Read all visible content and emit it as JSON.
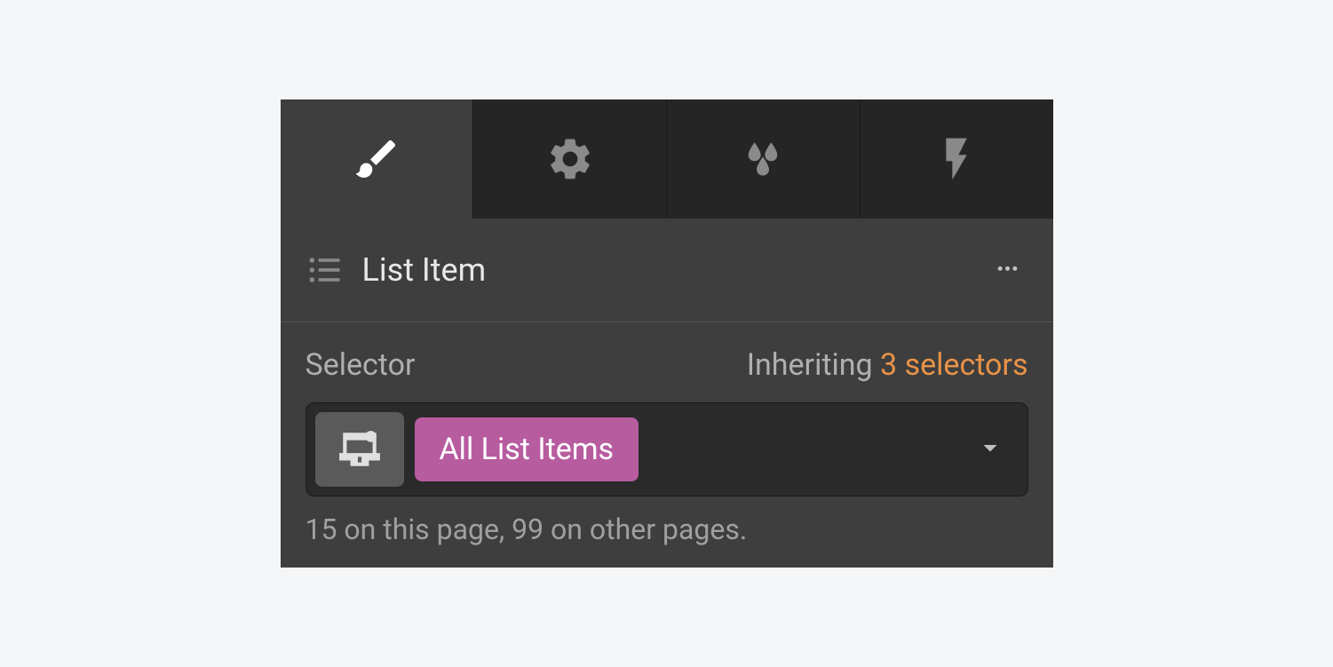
{
  "tabs": {
    "style": {
      "icon": "brush",
      "active": true
    },
    "settings": {
      "icon": "gear",
      "active": false
    },
    "effects": {
      "icon": "drops",
      "active": false
    },
    "interactions": {
      "icon": "bolt",
      "active": false
    }
  },
  "element": {
    "name": "List Item"
  },
  "selector": {
    "label": "Selector",
    "inheriting_label": "Inheriting",
    "inheriting_count": "3 selectors",
    "tag": "All List Items",
    "count_text": "15 on this page, 99 on other pages."
  }
}
